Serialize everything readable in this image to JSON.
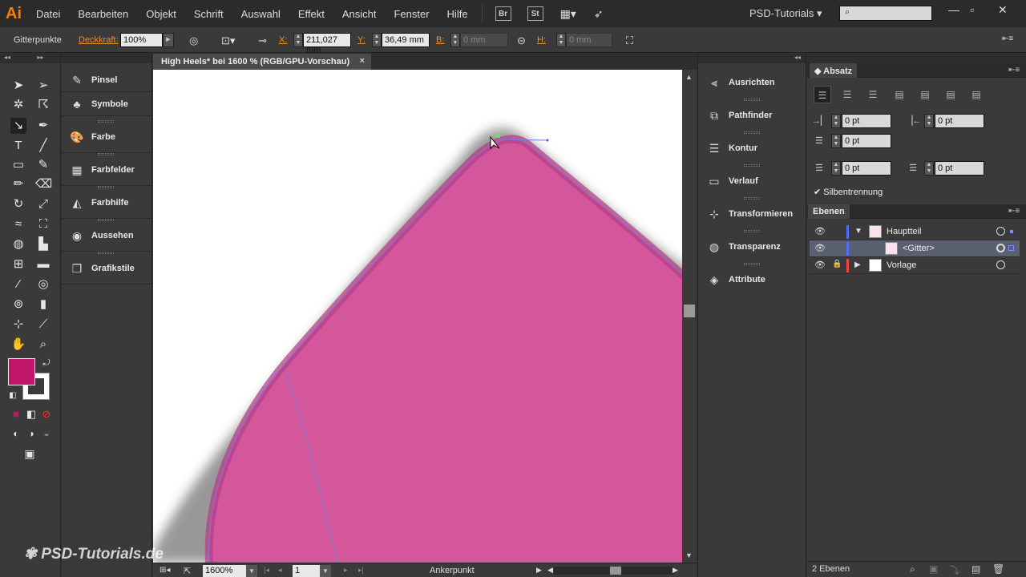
{
  "app": {
    "logo": "Ai",
    "workspace": "PSD-Tutorials",
    "menu": [
      "Datei",
      "Bearbeiten",
      "Objekt",
      "Schrift",
      "Auswahl",
      "Effekt",
      "Ansicht",
      "Fenster",
      "Hilfe"
    ],
    "bridge_btn": "Br",
    "stock_btn": "St"
  },
  "control": {
    "selection_label": "Gitterpunkte",
    "opacity_label": "Deckkraft:",
    "opacity_value": "100%",
    "x_label": "X:",
    "x_value": "211,027 mm",
    "y_label": "Y:",
    "y_value": "36,49 mm",
    "w_label": "B:",
    "w_value": "0 mm",
    "h_label": "H:",
    "h_value": "0 mm"
  },
  "left_panels": [
    "Pinsel",
    "Symbole",
    "Farbe",
    "Farbfelder",
    "Farbhilfe",
    "Aussehen",
    "Grafikstile"
  ],
  "document": {
    "tab_title": "High Heels* bei 1600 % (RGB/GPU-Vorschau)",
    "zoom": "1600%",
    "page": "1",
    "status_text": "Ankerpunkt"
  },
  "mid_panels": [
    "Ausrichten",
    "Pathfinder",
    "Kontur",
    "Verlauf",
    "Transformieren",
    "Transparenz",
    "Attribute"
  ],
  "paragraph": {
    "tab": "Absatz",
    "left_indent": "0 pt",
    "right_indent": "0 pt",
    "first_line_indent": "0 pt",
    "space_before": "0 pt",
    "space_after": "0 pt",
    "hyphenation": "Silbentrennung"
  },
  "layers": {
    "tab": "Ebenen",
    "rows": [
      {
        "name": "Hauptteil",
        "color": "#4f6cff"
      },
      {
        "name": "<Gitter>",
        "color": "#4f6cff"
      },
      {
        "name": "Vorlage",
        "color": "#ff4040"
      }
    ],
    "count": "2 Ebenen"
  },
  "colors": {
    "fill": "#c0166a",
    "shape": "#d4579c",
    "shape_edge": "#b83a85"
  },
  "watermark": "PSD-Tutorials.de"
}
